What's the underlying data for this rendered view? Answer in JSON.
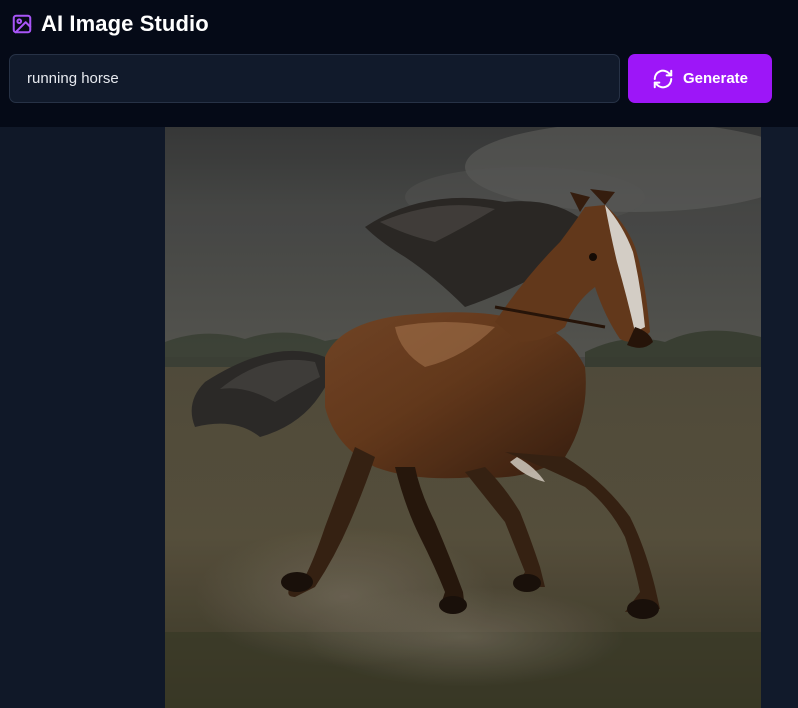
{
  "header": {
    "title": "AI Image Studio",
    "title_icon": "image-icon",
    "accent_color": "#a855f7"
  },
  "prompt": {
    "value": "running horse",
    "placeholder": ""
  },
  "generate_button": {
    "label": "Generate",
    "icon": "refresh-icon",
    "color": "#9d16f8"
  },
  "generated_image": {
    "subject": "running horse",
    "alt": "running horse"
  }
}
